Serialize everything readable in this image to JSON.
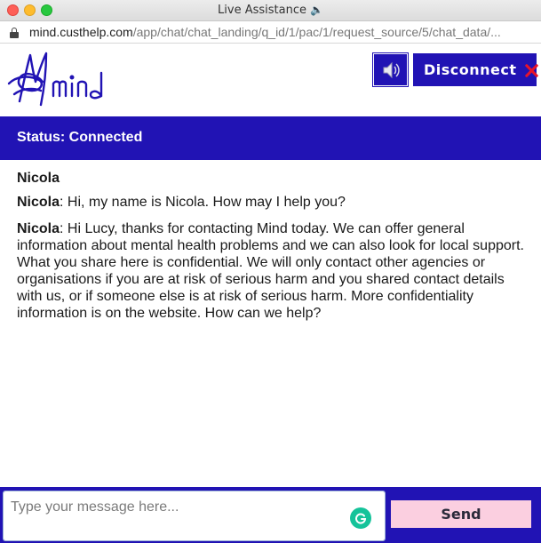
{
  "window": {
    "title": "Live Assistance",
    "title_icon": "speaker-icon"
  },
  "urlbar": {
    "host": "mind.custhelp.com",
    "path": "/app/chat/chat_landing/q_id/1/pac/1/request_source/5/chat_data/..."
  },
  "header": {
    "logo_text": "mind",
    "sound_button_icon": "speaker-icon",
    "disconnect_label": "Disconnect",
    "disconnect_icon": "close-icon",
    "accent_color": "#2113b4",
    "close_color": "#e8142a"
  },
  "status": {
    "text": "Status: Connected"
  },
  "transcript": {
    "agent_name": "Nicola",
    "messages": [
      {
        "sender": "Nicola",
        "text": ": Hi, my name is Nicola. How may I help you?"
      },
      {
        "sender": "Nicola",
        "text": ": Hi Lucy, thanks for contacting Mind today. We can offer general information about mental health problems and we can also look for local support. What you share here is confidential. We will only contact other agencies or organisations if you are at risk of serious harm and you shared contact details with us, or if someone else is at risk of serious harm.  More confidentiality information is on the website. How can we help?"
      }
    ]
  },
  "composer": {
    "placeholder": "Type your message here...",
    "value": "",
    "grammarly_icon": "grammarly-icon",
    "send_label": "Send",
    "send_color": "#fbcfe0"
  }
}
